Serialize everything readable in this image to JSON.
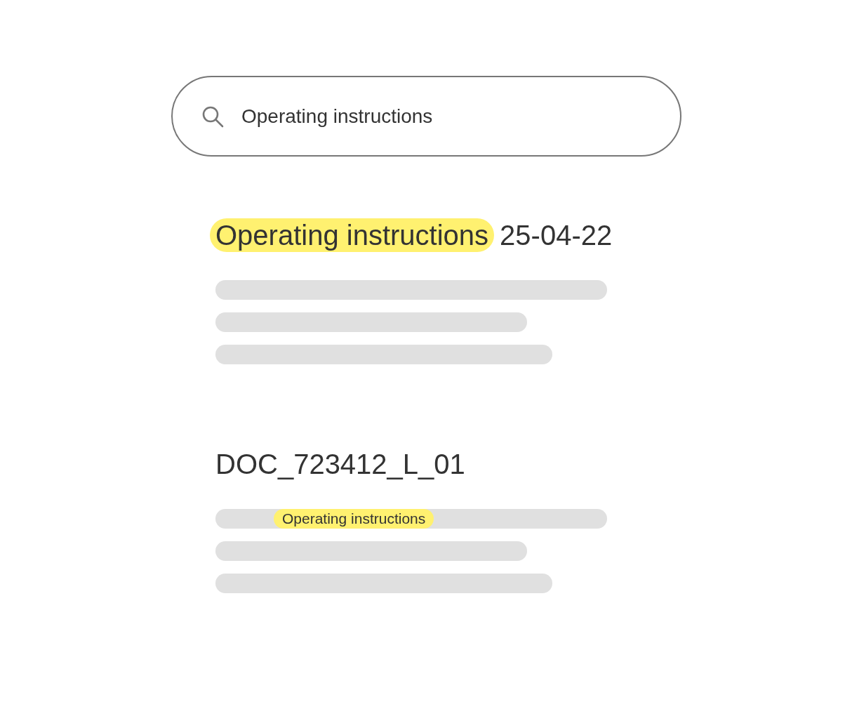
{
  "search": {
    "value": "Operating instructions"
  },
  "results": [
    {
      "title": [
        {
          "text": "Operating instructions",
          "highlighted": true
        },
        {
          "text": "25-04-22",
          "highlighted": false
        }
      ]
    },
    {
      "title": [
        {
          "text": "DOC_723412_L_01",
          "highlighted": false
        }
      ],
      "snippet": "Operating instructions"
    }
  ]
}
